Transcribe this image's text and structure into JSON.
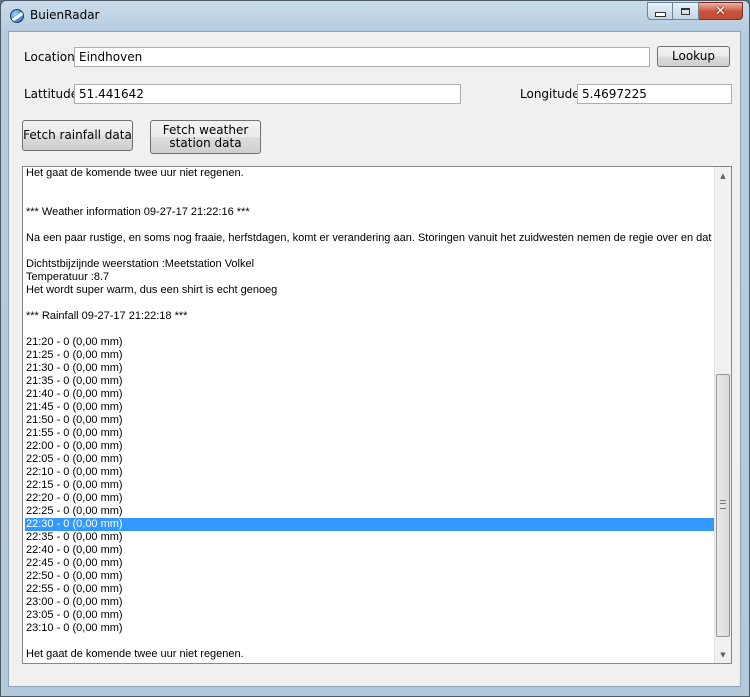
{
  "window": {
    "title": "BuienRadar",
    "minimize_icon": "minimize-icon",
    "maximize_icon": "maximize-icon",
    "close_icon": "close-icon"
  },
  "form": {
    "location_label": "Location",
    "location_value": "Eindhoven",
    "lookup_button": "Lookup",
    "latitude_label": "Lattitude",
    "latitude_value": "51.441642",
    "longitude_label": "Longitude",
    "longitude_value": "5.4697225",
    "fetch_rainfall_button": "Fetch rainfall data",
    "fetch_weather_button": "Fetch weather station data"
  },
  "output": {
    "lines": [
      "Het gaat de komende twee uur niet regenen.",
      "",
      "",
      "*** Weather information 09-27-17 21:22:16 ***",
      "",
      "Na een paar rustige, en soms nog fraaie, herfstdagen, komt er verandering aan. Storingen vanuit het zuidwesten nemen de regie over en dat betekent",
      "",
      "Dichtstbijzijnde weerstation :Meetstation Volkel",
      "Temperatuur :8.7",
      "Het wordt super warm,  dus een shirt is echt genoeg",
      "",
      "*** Rainfall 09-27-17 21:22:18 ***",
      "",
      "21:20 - 0 (0,00 mm)",
      "21:25 - 0 (0,00 mm)",
      "21:30 - 0 (0,00 mm)",
      "21:35 - 0 (0,00 mm)",
      "21:40 - 0 (0,00 mm)",
      "21:45 - 0 (0,00 mm)",
      "21:50 - 0 (0,00 mm)",
      "21:55 - 0 (0,00 mm)",
      "22:00 - 0 (0,00 mm)",
      "22:05 - 0 (0,00 mm)",
      "22:10 - 0 (0,00 mm)",
      "22:15 - 0 (0,00 mm)",
      "22:20 - 0 (0,00 mm)",
      "22:25 - 0 (0,00 mm)",
      "22:30 - 0 (0,00 mm)",
      "22:35 - 0 (0,00 mm)",
      "22:40 - 0 (0,00 mm)",
      "22:45 - 0 (0,00 mm)",
      "22:50 - 0 (0,00 mm)",
      "22:55 - 0 (0,00 mm)",
      "23:00 - 0 (0,00 mm)",
      "23:05 - 0 (0,00 mm)",
      "23:10 - 0 (0,00 mm)",
      "",
      "Het gaat de komende twee uur niet regenen."
    ],
    "selected_line": "22:30 - 0 (0,00 mm)"
  },
  "colors": {
    "selection": "#3399ff",
    "window_frame": "#b6cde0",
    "close_button": "#c9513a"
  }
}
